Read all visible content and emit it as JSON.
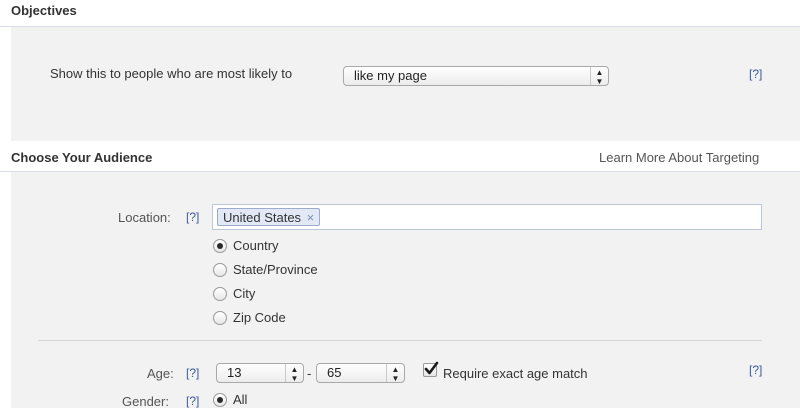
{
  "objectives": {
    "title": "Objectives",
    "prompt": "Show this to people who are most likely to",
    "selected_goal": "like my page",
    "help": "[?]"
  },
  "audience": {
    "title": "Choose Your Audience",
    "learn_more": "Learn More About Targeting",
    "location": {
      "label": "Location:",
      "help": "[?]",
      "token": "United States",
      "token_remove": "×",
      "options": [
        "Country",
        "State/Province",
        "City",
        "Zip Code"
      ],
      "selected": "Country"
    },
    "age": {
      "label": "Age:",
      "help": "[?]",
      "min": "13",
      "separator": "-",
      "max": "65",
      "exact_match_label": "Require exact age match",
      "exact_match_checked": true,
      "row_help": "[?]"
    },
    "gender": {
      "label": "Gender:",
      "help": "[?]",
      "selected": "All"
    }
  }
}
